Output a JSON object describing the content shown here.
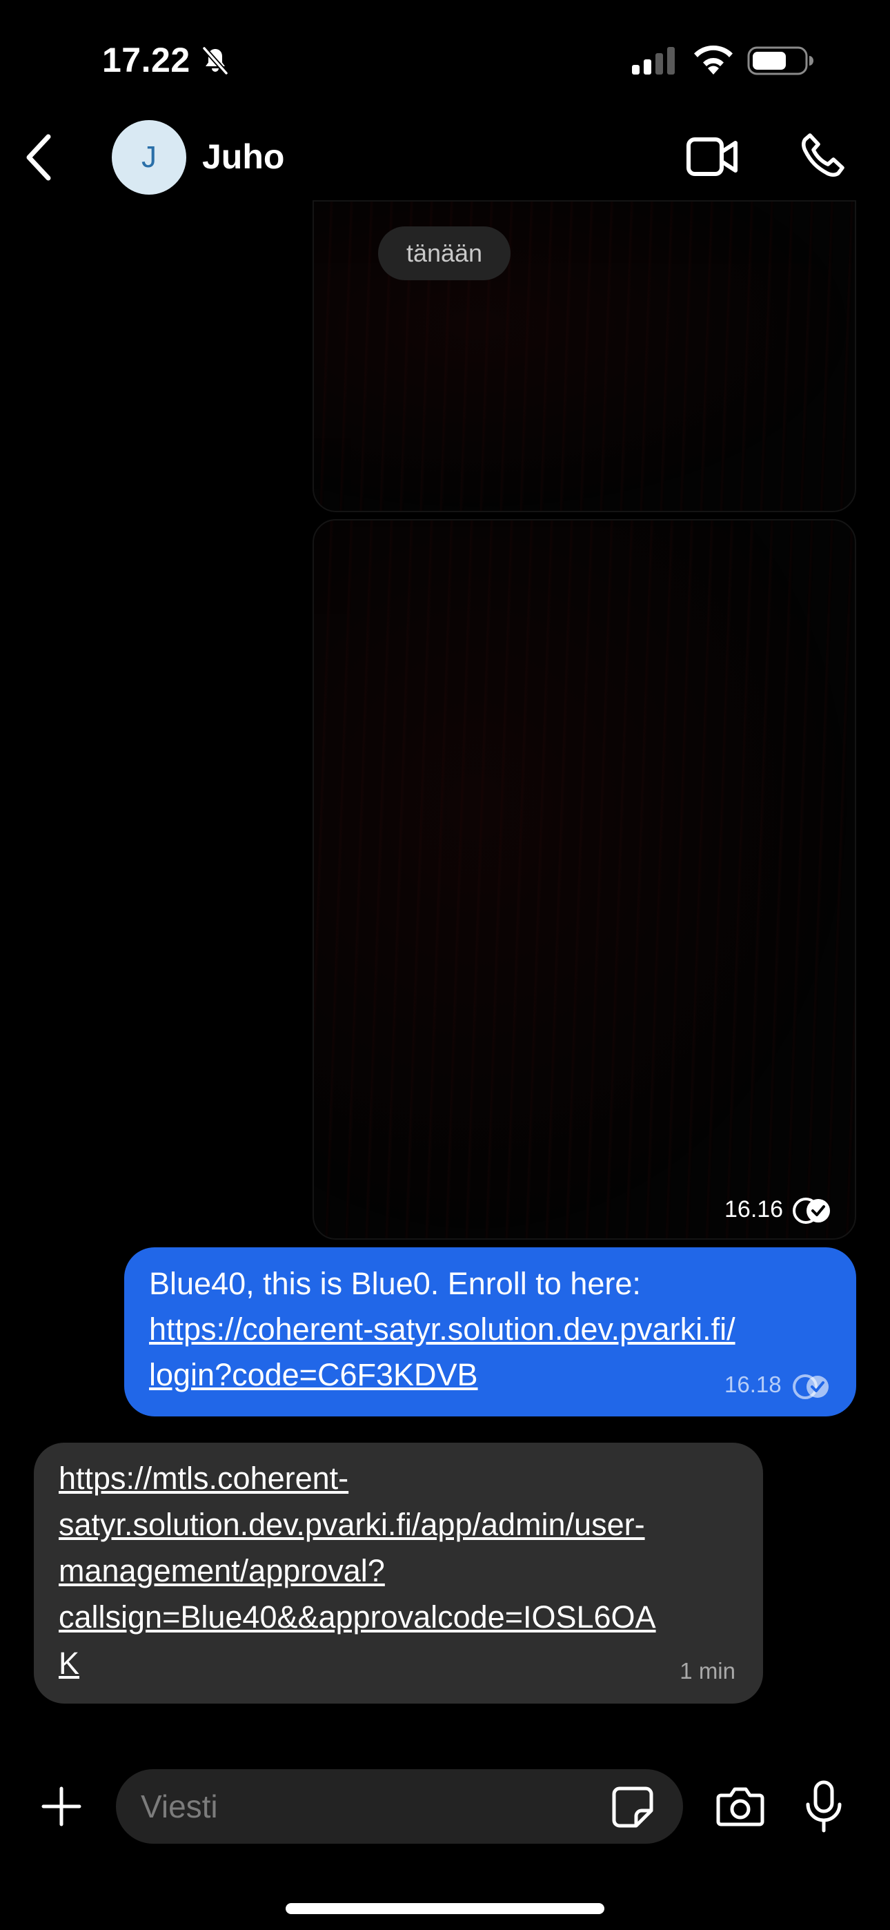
{
  "status_bar": {
    "time": "17.22",
    "icons": [
      "bell-slash-icon",
      "signal-icon",
      "wifi-icon",
      "battery-icon"
    ]
  },
  "header": {
    "avatar_initial": "J",
    "contact_name": "Juho",
    "icons": [
      "chevron-left-icon",
      "video-call-icon",
      "phone-icon"
    ]
  },
  "chat": {
    "date_separator": "tänään",
    "media_message": {
      "time": "16.16",
      "status_icon": "read-check-icon"
    },
    "outgoing_message": {
      "text": "Blue40, this is Blue0. Enroll to here:",
      "link_line_1": "https://coherent-satyr.solution.dev.pvarki.fi/",
      "link_line_2": "login?code=C6F3KDVB",
      "time": "16.18",
      "status_icon": "read-check-icon"
    },
    "incoming_message": {
      "link_lines": [
        "https://mtls.coherent-",
        "satyr.solution.dev.pvarki.fi/app/admin/user-",
        "management/approval?",
        "callsign=Blue40&&approvalcode=IOSL6OA",
        "K"
      ],
      "time": "1 min"
    }
  },
  "composer": {
    "placeholder": "Viesti",
    "icons": [
      "plus-icon",
      "sticker-icon",
      "camera-icon",
      "microphone-icon"
    ]
  },
  "colors": {
    "background": "#000000",
    "outgoing_bubble": "#2167E8",
    "incoming_bubble": "#2F2F2F",
    "avatar_bg": "#D9E9F3",
    "avatar_text": "#2A6FA8"
  }
}
